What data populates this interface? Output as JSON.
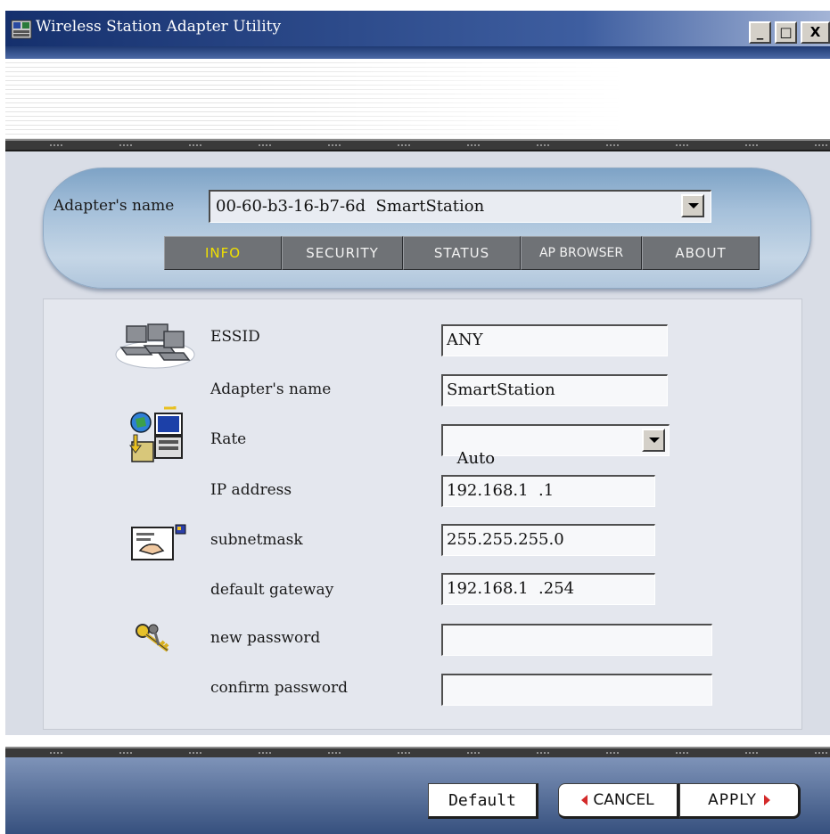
{
  "window": {
    "title": "Wireless Station Adapter Utility",
    "minimize_label": "_",
    "maximize_label": "□",
    "close_label": "X"
  },
  "header": {
    "adapter_label": "Adapter's name",
    "adapter_value": "00-60-b3-16-b7-6d  SmartStation"
  },
  "tabs": [
    {
      "label": "INFO",
      "active": true
    },
    {
      "label": "SECURITY",
      "active": false
    },
    {
      "label": "STATUS",
      "active": false
    },
    {
      "label": "AP BROWSER",
      "active": false
    },
    {
      "label": "ABOUT",
      "active": false
    }
  ],
  "form": {
    "essid": {
      "label": "ESSID",
      "value": "ANY"
    },
    "adapter_name": {
      "label": "Adapter's name",
      "value": "SmartStation"
    },
    "rate": {
      "label": "Rate",
      "value": "Auto"
    },
    "ip_address": {
      "label": "IP address",
      "value": "192.168.1  .1"
    },
    "subnetmask": {
      "label": "subnetmask",
      "value": "255.255.255.0"
    },
    "default_gateway": {
      "label": "default gateway",
      "value": "192.168.1  .254"
    },
    "new_password": {
      "label": "new password",
      "value": ""
    },
    "confirm_password": {
      "label": "confirm password",
      "value": ""
    }
  },
  "footer": {
    "default_label": "Default",
    "cancel_label": "CANCEL",
    "apply_label": "APPLY"
  },
  "icons": {
    "network": "network-computers-icon",
    "transfer": "computer-transfer-icon",
    "hand": "hand-card-icon",
    "keys": "keys-icon"
  },
  "colors": {
    "title_bar": "#15306d",
    "tab_bg": "#6f7276",
    "tab_active_text": "#f0e000",
    "pill": "#a5c0da",
    "panel": "#e4e7ee",
    "footer": "#36507e"
  }
}
